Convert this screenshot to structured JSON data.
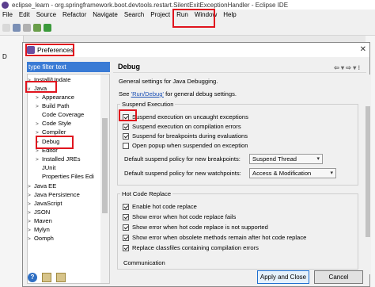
{
  "eclipse": {
    "title": "eclipse_learn - org.springframework.boot.devtools.restart.SilentExitExceptionHandler - Eclipse IDE",
    "menu": [
      "File",
      "Edit",
      "Source",
      "Refactor",
      "Navigate",
      "Search",
      "Project",
      "Run",
      "Window",
      "Help"
    ],
    "left_tab": "D"
  },
  "dialog": {
    "title": "Preferences",
    "filter_placeholder": "type filter text",
    "tree": [
      {
        "label": "Install/Update",
        "expanded": false
      },
      {
        "label": "Java",
        "expanded": true
      },
      {
        "label": "Appearance",
        "expanded": false
      },
      {
        "label": "Build Path",
        "expanded": false
      },
      {
        "label": "Code Coverage",
        "expanded": null
      },
      {
        "label": "Code Style",
        "expanded": false
      },
      {
        "label": "Compiler",
        "expanded": false
      },
      {
        "label": "Debug",
        "expanded": false
      },
      {
        "label": "Editor",
        "expanded": false
      },
      {
        "label": "Installed JREs",
        "expanded": false
      },
      {
        "label": "JUnit",
        "expanded": null
      },
      {
        "label": "Properties Files Edi",
        "expanded": null
      },
      {
        "label": "Java EE",
        "expanded": false
      },
      {
        "label": "Java Persistence",
        "expanded": false
      },
      {
        "label": "JavaScript",
        "expanded": false
      },
      {
        "label": "JSON",
        "expanded": false
      },
      {
        "label": "Maven",
        "expanded": false
      },
      {
        "label": "Mylyn",
        "expanded": false
      },
      {
        "label": "Oomph",
        "expanded": false
      }
    ],
    "page_title": "Debug",
    "description": "General settings for Java Debugging.",
    "see_prefix": "See ",
    "see_link": "'Run/Debug'",
    "see_suffix": " for general debug settings.",
    "suspend_group": {
      "title": "Suspend Execution",
      "options": [
        {
          "label": "Suspend execution on uncaught exceptions",
          "checked": true
        },
        {
          "label": "Suspend execution on compilation errors",
          "checked": true
        },
        {
          "label": "Suspend for breakpoints during evaluations",
          "checked": true
        },
        {
          "label": "Open popup when suspended on exception",
          "checked": false
        }
      ],
      "default_breakpoints_label": "Default suspend policy for new breakpoints:",
      "default_breakpoints_value": "Suspend Thread",
      "default_watchpoints_label": "Default suspend policy for new watchpoints:",
      "default_watchpoints_value": "Access & Modification"
    },
    "hcr_group": {
      "title": "Hot Code Replace",
      "options": [
        {
          "label": "Enable hot code replace",
          "checked": true
        },
        {
          "label": "Show error when hot code replace fails",
          "checked": true
        },
        {
          "label": "Show error when hot code replace is not supported",
          "checked": true
        },
        {
          "label": "Show error when obsolete methods remain after hot code replace",
          "checked": true
        },
        {
          "label": "Replace classfiles containing compilation errors",
          "checked": true
        }
      ]
    },
    "communication_label": "Communication",
    "buttons": {
      "apply_close": "Apply and Close",
      "cancel": "Cancel"
    },
    "help_icon": "?"
  }
}
